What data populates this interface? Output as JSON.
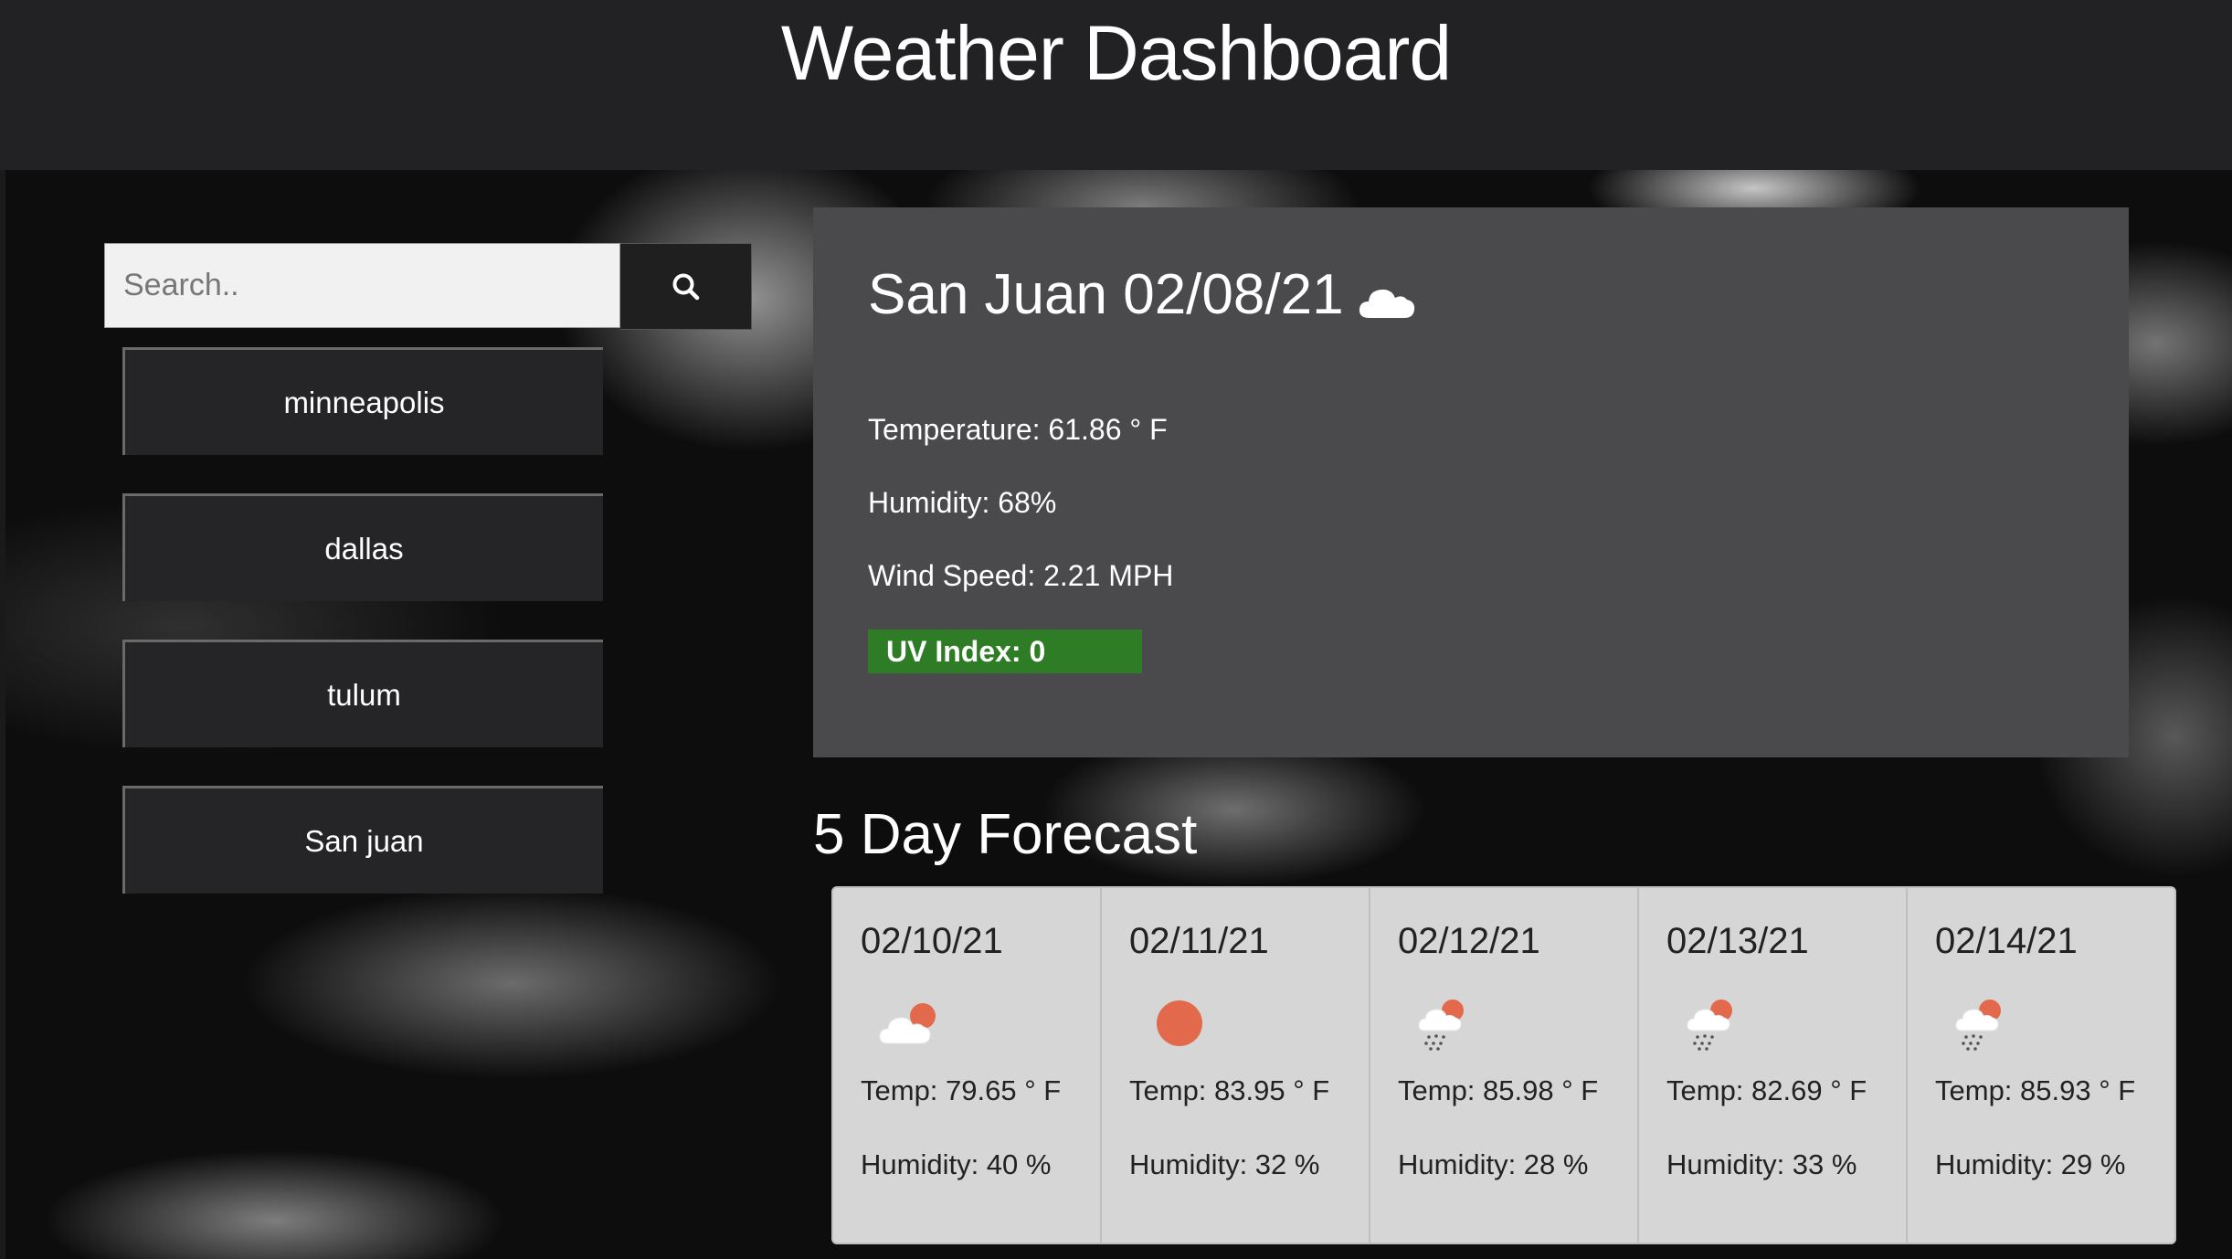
{
  "header": {
    "title": "Weather Dashboard"
  },
  "search": {
    "placeholder": "Search..",
    "value": "",
    "button_icon": "search-icon"
  },
  "history": [
    {
      "label": "minneapolis"
    },
    {
      "label": "dallas"
    },
    {
      "label": "tulum"
    },
    {
      "label": "San juan"
    }
  ],
  "current": {
    "heading": "San Juan 02/08/21",
    "icon": "cloud-icon",
    "temperature": "Temperature: 61.86 ° F",
    "humidity": "Humidity: 68%",
    "wind": "Wind Speed: 2.21 MPH",
    "uv": "UV Index: 0",
    "uv_color": "#2e7d26"
  },
  "forecast": {
    "title": "5 Day Forecast",
    "days": [
      {
        "date": "02/10/21",
        "icon": "partly-cloudy-icon",
        "temp": "Temp: 79.65 ° F",
        "humidity": "Humidity: 40 %"
      },
      {
        "date": "02/11/21",
        "icon": "sun-icon",
        "temp": "Temp: 83.95 ° F",
        "humidity": "Humidity: 32 %"
      },
      {
        "date": "02/12/21",
        "icon": "sun-rain-icon",
        "temp": "Temp: 85.98 ° F",
        "humidity": "Humidity: 28 %"
      },
      {
        "date": "02/13/21",
        "icon": "sun-rain-icon",
        "temp": "Temp: 82.69 ° F",
        "humidity": "Humidity: 33 %"
      },
      {
        "date": "02/14/21",
        "icon": "sun-rain-icon",
        "temp": "Temp: 85.93 ° F",
        "humidity": "Humidity: 29 %"
      }
    ]
  },
  "colors": {
    "header_bg": "#222225",
    "panel_bg": "#4a4a4d",
    "card_bg": "#d6d6d6",
    "sun": "#e2694b"
  }
}
